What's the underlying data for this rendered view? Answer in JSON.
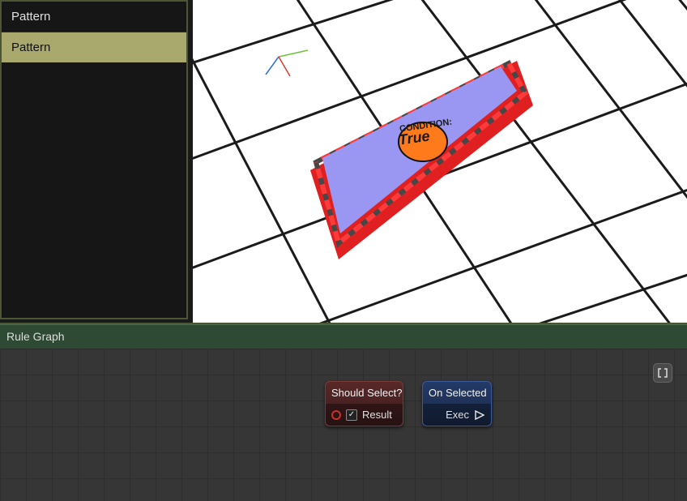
{
  "sidebar": {
    "items": [
      {
        "label": "Pattern",
        "selected": false
      },
      {
        "label": "Pattern",
        "selected": true
      }
    ]
  },
  "viewport": {
    "condition_label": "CONDITION:",
    "condition_value": "True"
  },
  "rulegraph": {
    "title": "Rule Graph",
    "node_red": {
      "title": "Should Select?",
      "result_label": "Result"
    },
    "node_blue": {
      "title": "On Selected",
      "exec_label": "Exec"
    }
  }
}
